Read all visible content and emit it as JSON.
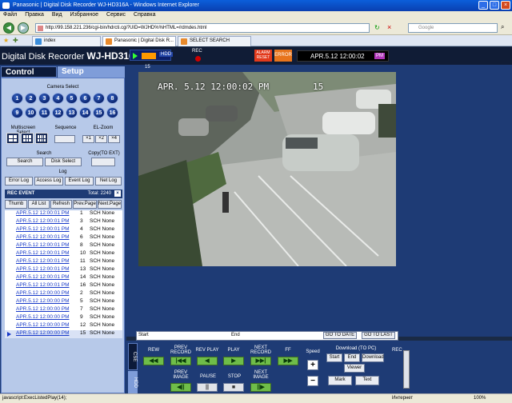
{
  "window": {
    "title": "Panasonic | Digital Disk Recorder WJ-HD316A - Windows Internet Explorer"
  },
  "menu": [
    "Файл",
    "Правка",
    "Вид",
    "Избранное",
    "Сервис",
    "Справка"
  ],
  "address": {
    "url": "http://99.158.221.236/cgi-bin/hdrcti.cgi?UID=WJHD%%HTML=/rdmdes.html"
  },
  "search": {
    "placeholder": "Google"
  },
  "tabs": [
    {
      "label": "index"
    },
    {
      "label": "Panasonic | Digital Disk R..."
    },
    {
      "label": "SELECT SEARCH"
    }
  ],
  "header": {
    "app_title": "Digital Disk Recorder",
    "model": "WJ-HD316A",
    "hdd_label": "HDD",
    "rec_label": "REC",
    "alarm_label": "ALARM RESET",
    "error_label": "ERROR",
    "datetime": "APR.5.12 12:00:02",
    "ampm": "PM"
  },
  "left": {
    "tab_control": "Control",
    "tab_setup": "Setup",
    "camera_select_label": "Camera Select",
    "cameras": [
      "1",
      "2",
      "3",
      "4",
      "5",
      "6",
      "7",
      "8",
      "9",
      "10",
      "11",
      "12",
      "13",
      "14",
      "15",
      "16"
    ],
    "multiscreen_label": "Multiscreen Select",
    "sequence_label": "Sequence",
    "elzoom_label": "EL-Zoom",
    "zoom_x1": "×1",
    "zoom_x2": "×2",
    "zoom_x4": "×4",
    "search_label": "Search",
    "copy_label": "Copy(TO EXT)",
    "search_btn": "Search",
    "disk_select_btn": "Disk Select",
    "log_label": "Log",
    "log_buttons": [
      "Error Log",
      "Access Log",
      "Event Log",
      "Net Log"
    ],
    "rec_event_title": "REC EVENT",
    "rec_event_total": "Total: 2240",
    "rec_event_close": "×",
    "event_buttons": [
      "Thumb",
      "All List",
      "Refresh",
      "Prev.Page",
      "Next.Page"
    ],
    "events": [
      {
        "date": "APR.5.12 12:00:01 PM",
        "cam": "1",
        "type": "SCH None"
      },
      {
        "date": "APR.5.12 12:00:01 PM",
        "cam": "3",
        "type": "SCH None"
      },
      {
        "date": "APR.5.12 12:00:01 PM",
        "cam": "4",
        "type": "SCH None"
      },
      {
        "date": "APR.5.12 12:00:01 PM",
        "cam": "6",
        "type": "SCH None"
      },
      {
        "date": "APR.5.12 12:00:01 PM",
        "cam": "8",
        "type": "SCH None"
      },
      {
        "date": "APR.5.12 12:00:01 PM",
        "cam": "10",
        "type": "SCH None"
      },
      {
        "date": "APR.5.12 12:00:01 PM",
        "cam": "11",
        "type": "SCH None"
      },
      {
        "date": "APR.5.12 12:00:01 PM",
        "cam": "13",
        "type": "SCH None"
      },
      {
        "date": "APR.5.12 12:00:01 PM",
        "cam": "14",
        "type": "SCH None"
      },
      {
        "date": "APR.5.12 12:00:01 PM",
        "cam": "16",
        "type": "SCH None"
      },
      {
        "date": "APR.5.12 12:00:00 PM",
        "cam": "2",
        "type": "SCH None"
      },
      {
        "date": "APR.5.12 12:00:00 PM",
        "cam": "5",
        "type": "SCH None"
      },
      {
        "date": "APR.5.12 12:00:00 PM",
        "cam": "7",
        "type": "SCH None"
      },
      {
        "date": "APR.5.12 12:00:00 PM",
        "cam": "9",
        "type": "SCH None"
      },
      {
        "date": "APR.5.12 12:00:00 PM",
        "cam": "12",
        "type": "SCH None"
      },
      {
        "date": "APR.5.12 12:00:00 PM",
        "cam": "15",
        "type": "SCH None"
      }
    ]
  },
  "viewer": {
    "camera_number": "15",
    "overlay_datetime": "APR. 5.12 12:00:02 PM",
    "overlay_cam": "15"
  },
  "timeline": {
    "start_label": "Start",
    "end_label": "End",
    "goto_date": "GO TO DATE",
    "goto_last": "GO TO LAST"
  },
  "playback": {
    "cse_tab": "CSE",
    "hdd_tab": "HDD",
    "labels_top": [
      "REW",
      "PREV RECORD",
      "REV PLAY",
      "PLAY",
      "NEXT RECORD",
      "FF"
    ],
    "labels_bottom": [
      "PREV IMAGE",
      "PAUSE",
      "STOP",
      "NEXT IMAGE"
    ],
    "icons_top": [
      "◀◀",
      "|◀◀",
      "◀",
      "▶",
      "▶▶|",
      "▶▶"
    ],
    "icons_bottom": [
      "◀||",
      "||",
      "■",
      "||▶"
    ],
    "speed_label": "Speed",
    "speed_plus": "+",
    "speed_minus": "−",
    "download_label": "Download (TO PC)",
    "start_btn": "Start",
    "end_btn": "End",
    "download_btn": "Download",
    "viewer_btn": "Viewer",
    "mark_btn": "Mark",
    "text_btn": "Text",
    "rec_label": "REC"
  },
  "status": {
    "text": "javascript:ExecListedPlay(14);",
    "zone": "Интернет",
    "zoom": "100%"
  }
}
